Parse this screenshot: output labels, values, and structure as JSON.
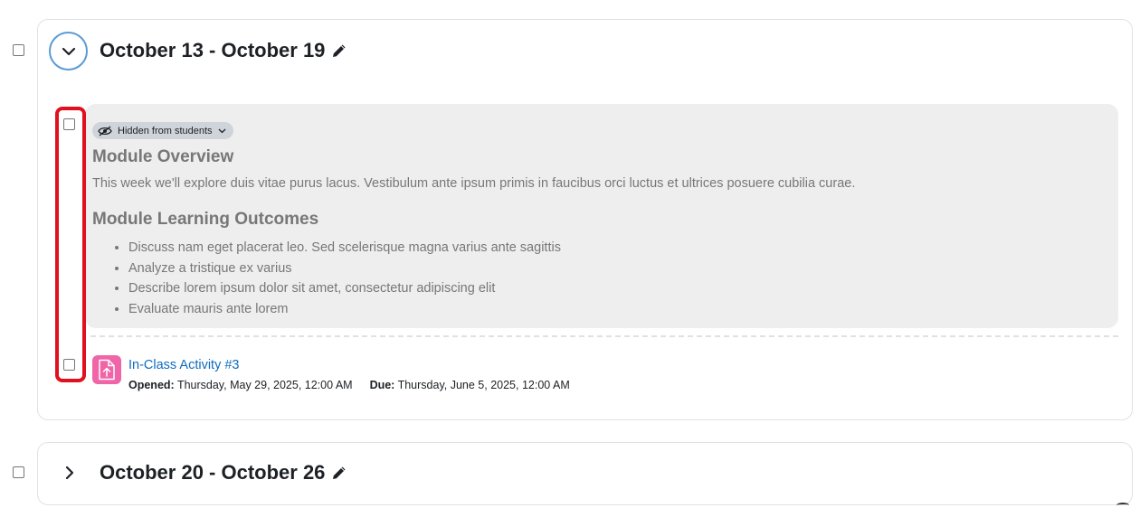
{
  "sections": [
    {
      "title": "October 13 - October 19",
      "expanded": true,
      "summary": {
        "badge": "Hidden from students",
        "overview_heading": "Module Overview",
        "overview_text": "This week we'll explore duis vitae purus lacus. Vestibulum ante ipsum primis in faucibus orci luctus et ultrices posuere cubilia curae.",
        "outcomes_heading": "Module Learning Outcomes",
        "outcomes": [
          "Discuss nam eget placerat leo. Sed scelerisque magna varius ante sagittis",
          "Analyze a tristique ex varius",
          "Describe lorem ipsum dolor sit amet, consectetur adipiscing elit",
          "Evaluate mauris ante lorem"
        ]
      },
      "activity": {
        "name": "In-Class Activity #3",
        "opened_label": "Opened:",
        "opened_value": "Thursday, May 29, 2025, 12:00 AM",
        "due_label": "Due:",
        "due_value": "Thursday, June 5, 2025, 12:00 AM",
        "icon": "assignment-upload-icon",
        "icon_color": "#f065a8"
      }
    },
    {
      "title": "October 20 - October 26",
      "expanded": false
    }
  ],
  "colors": {
    "link": "#0f6cbf",
    "highlight": "#e0101e",
    "summary_bg": "#eeeeee",
    "collapse_ring": "#5b9bd5"
  }
}
